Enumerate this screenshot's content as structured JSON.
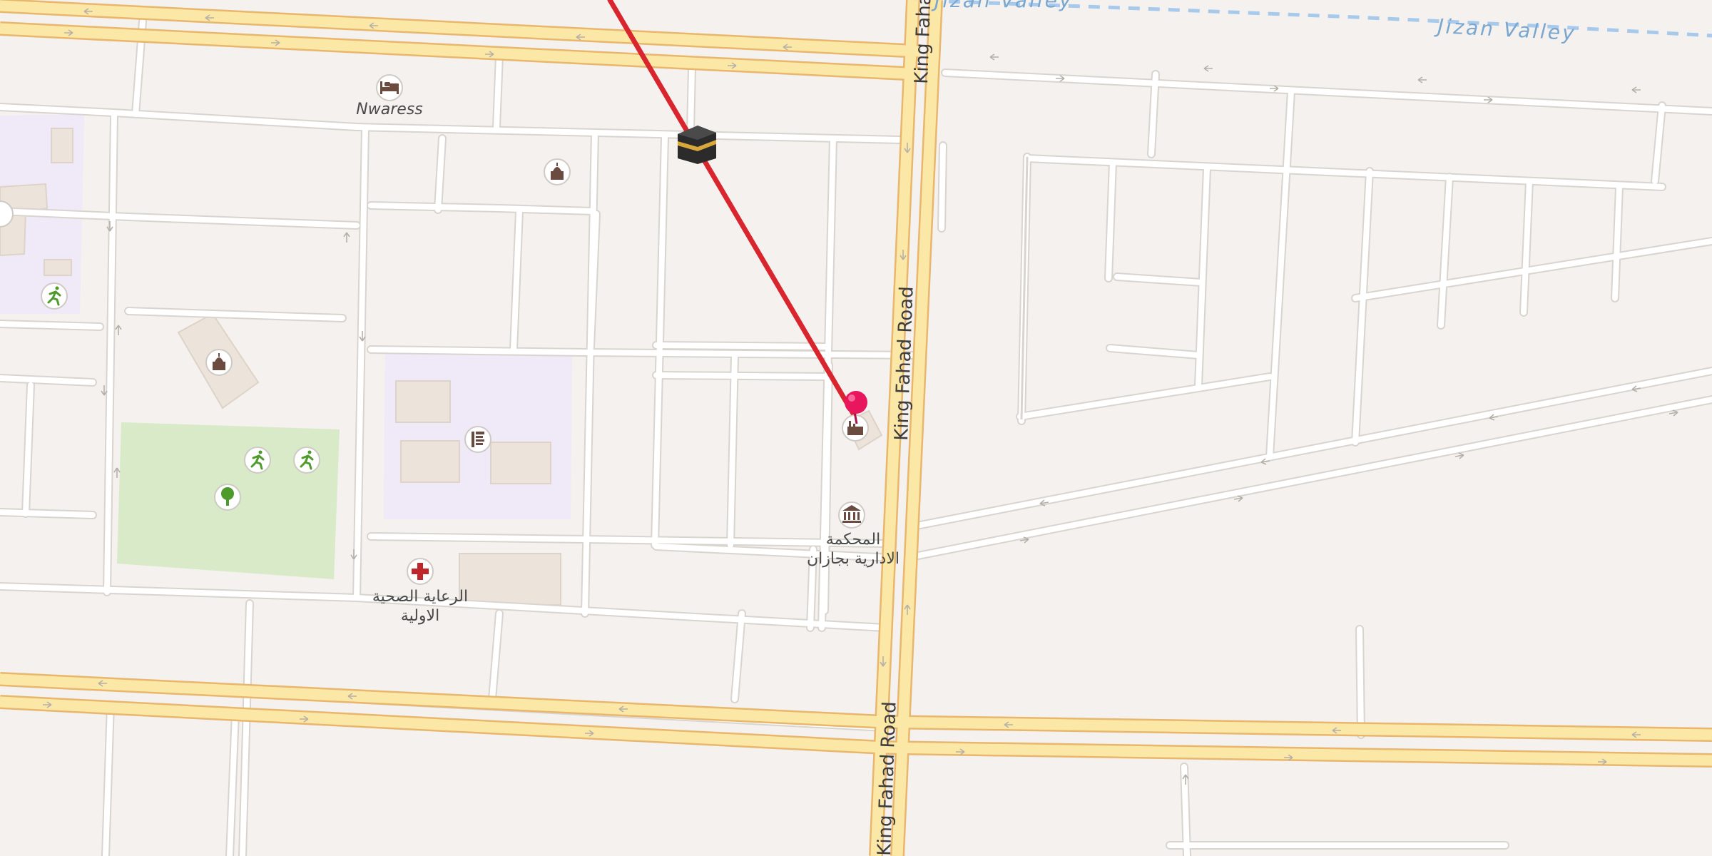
{
  "map": {
    "roads": {
      "king_fahad_upper": "King Fahad",
      "king_fahad_middle": "King Fahad Road",
      "king_fahad_lower": "King Fahad Road"
    },
    "water": {
      "name_left": "Jizan Valley",
      "name_right": "Jizan Valley"
    },
    "pois": {
      "hotel": {
        "name": "Nwaress",
        "icon": "bed-icon"
      },
      "mosque_a": {
        "icon": "mosque-icon"
      },
      "mosque_b": {
        "icon": "mosque-icon"
      },
      "kaaba": {
        "icon": "kaaba-icon"
      },
      "school": {
        "icon": "school-icon"
      },
      "healthcare": {
        "name_line1": "الرعاية الصحية",
        "name_line2": "الاولية",
        "icon": "medical-cross-icon"
      },
      "court": {
        "name_line1": "المحكمة",
        "name_line2": "الادارية بجازان",
        "icon": "government-building-icon"
      },
      "factory": {
        "icon": "factory-icon"
      },
      "playground_1": {
        "icon": "running-person-icon"
      },
      "playground_2": {
        "icon": "running-person-icon"
      },
      "playground_3": {
        "icon": "running-person-icon"
      },
      "park_tree": {
        "icon": "tree-icon"
      }
    },
    "route": {
      "color": "#d9262e"
    },
    "marker": {
      "color": "#e8165d",
      "icon": "location-pin-icon"
    },
    "colors": {
      "background": "#f4f1ee",
      "major_road": "#fce8a6",
      "major_road_casing": "#e9b66d",
      "minor_road": "#ffffff",
      "minor_road_casing": "#d9d4ce",
      "building": "#ece3da",
      "school_area": "#efe9f8",
      "park": "#d8eac7",
      "water_line": "#a7c9eb"
    }
  }
}
